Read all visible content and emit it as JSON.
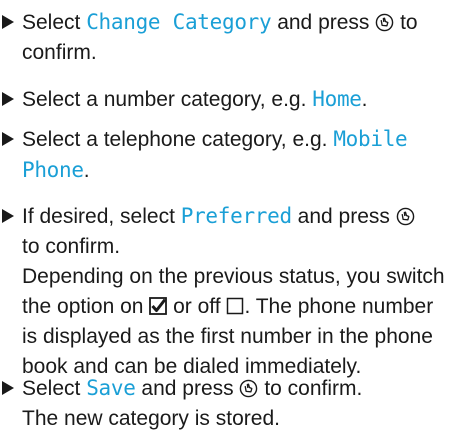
{
  "steps": [
    {
      "before": "Select ",
      "ui": "Change Category",
      "after": " and press ",
      "tail": " to confirm."
    },
    {
      "before": "Select a number category, e.g. ",
      "ui": "Home",
      "after": "."
    },
    {
      "before": "Select a telephone category, e.g. ",
      "ui": "Mobile Phone",
      "after": "."
    },
    {
      "before": "If desired, select ",
      "ui": "Preferred",
      "after": " and press ",
      "tail": " to confirm.",
      "note_1": "Depending on the previous status, you switch the option on ",
      "note_2": " or off ",
      "note_3": ". The phone number is displayed as the first number in the phone book and can be dialed immediately."
    },
    {
      "before": "Select ",
      "ui": "Save",
      "after": " and press ",
      "tail": " to confirm.",
      "result": "The new category is stored."
    }
  ],
  "icons": {
    "bullet": "triangle-bullet-icon",
    "confirm_button": "confirm-button-icon",
    "checkbox_on": "checkbox-checked-icon",
    "checkbox_off": "checkbox-empty-icon"
  },
  "colors": {
    "ui_text": "#1a9fd6",
    "text": "#1a1a1a"
  }
}
